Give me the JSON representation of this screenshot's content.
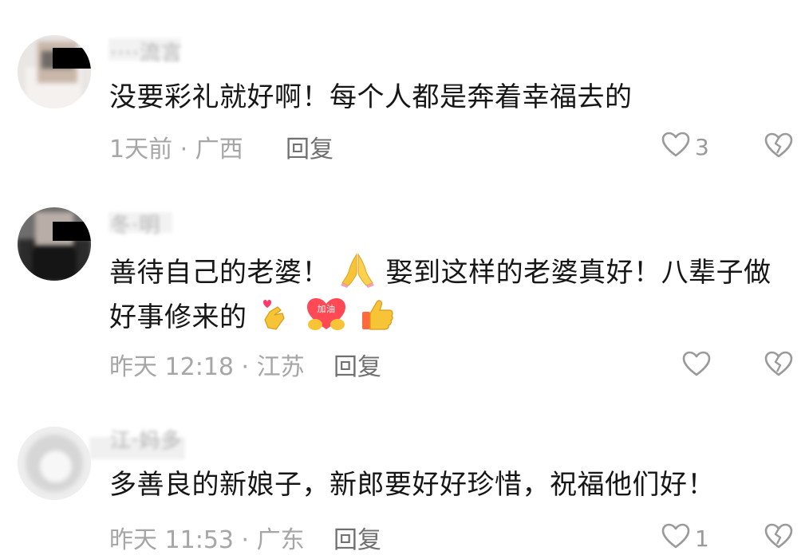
{
  "comments": [
    {
      "username": "····流言",
      "text": "没要彩礼就好啊！每个人都是奔着幸福去的",
      "meta": "1天前 · 广西",
      "reply_label": "回复",
      "likes": "3",
      "icons": {
        "like": "heart-outline-icon",
        "dislike": "broken-heart-outline-icon"
      }
    },
    {
      "username": "冬·明",
      "text_part1": "善待自己的老婆！",
      "text_part2": "娶到这样的老婆真好！八辈子做好事修来的",
      "emoji_labels": {
        "jiayou": "加油"
      },
      "meta": "昨天 12:18 · 江苏",
      "reply_label": "回复",
      "likes": "",
      "icons": {
        "like": "heart-outline-icon",
        "dislike": "broken-heart-outline-icon"
      }
    },
    {
      "username": "江·妈多",
      "text": "多善良的新娘子，新郎要好好珍惜，祝福他们好！",
      "meta": "昨天 11:53 · 广东",
      "reply_label": "回复",
      "likes": "1",
      "icons": {
        "like": "heart-outline-icon",
        "dislike": "broken-heart-outline-icon"
      }
    }
  ],
  "colors": {
    "text": "#161616",
    "meta": "#a6a6a6",
    "reply": "#707070",
    "icon": "#9a9a9a"
  }
}
